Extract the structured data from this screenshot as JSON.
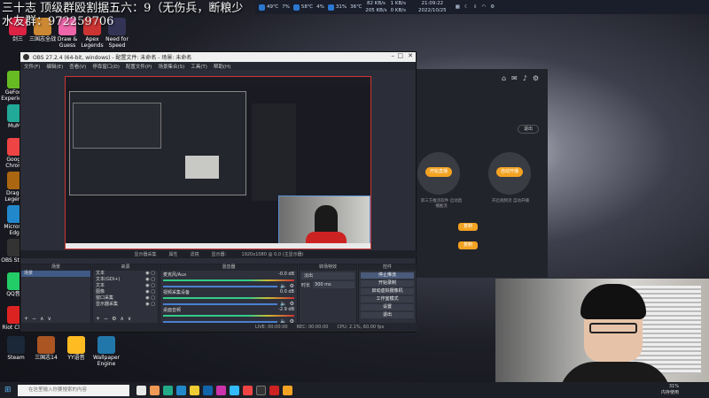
{
  "overlay": {
    "line1": "三十志 顶级群殴割据五六：9（无伤兵，断粮少",
    "line2": "水友群：972259706"
  },
  "monitor": {
    "cpu_temp": "49℃",
    "cpu_load": "7%",
    "gpu_temp": "58℃",
    "gpu_load": "4%",
    "mem": "31%",
    "disk_temp": "36℃",
    "net_up": "82 KB/s",
    "net_down": "205 KB/s",
    "net2_up": "1 KB/s",
    "net2_down": "0 KB/s",
    "time": "21:09:22",
    "date": "2022/10/25"
  },
  "desktop_icons": [
    {
      "label": "剑三",
      "color": "#d24"
    },
    {
      "label": "三国志全战",
      "color": "#c83"
    },
    {
      "label": "Draw & Guess",
      "color": "#e6a"
    },
    {
      "label": "Apex Legends",
      "color": "#c33"
    },
    {
      "label": "Need for Speed",
      "color": "#335"
    },
    {
      "label": "GeForce Experience",
      "color": "#6b2"
    },
    {
      "label": "MuMu",
      "color": "#2a9"
    },
    {
      "label": "Google Chrome",
      "color": "#e44"
    },
    {
      "label": "Dragon Legends",
      "color": "#a61"
    },
    {
      "label": "Microsoft Edge",
      "color": "#28c"
    },
    {
      "label": "OBS Studio",
      "color": "#333"
    },
    {
      "label": "QQ音乐",
      "color": "#2c6"
    },
    {
      "label": "Riot Client",
      "color": "#d22"
    },
    {
      "label": "Steam",
      "color": "#1b2838"
    },
    {
      "label": "三国志14",
      "color": "#a52"
    },
    {
      "label": "YY语音",
      "color": "#fb2"
    },
    {
      "label": "Wallpaper Engine",
      "color": "#27a"
    }
  ],
  "obs": {
    "title": "OBS 27.2.4 (64-bit, windows) - 配置文件: 未命名 - 场景: 未命名",
    "menu": [
      "文件(F)",
      "编辑(E)",
      "查看(V)",
      "停靠窗口(D)",
      "配置文件(P)",
      "场景集合(S)",
      "工具(T)",
      "帮助(H)"
    ],
    "preview_info": [
      "显示器采集",
      "属性",
      "滤镜",
      "显示器：",
      "1920x1080 @ 0,0 (主显示器)"
    ],
    "docks": {
      "scenes": {
        "header": "场景",
        "items": [
          "场景"
        ]
      },
      "sources": {
        "header": "来源",
        "items": [
          "文本",
          "文本(GDI+)",
          "文本",
          "图像",
          "窗口采集",
          "显示器采集"
        ]
      },
      "mixer": {
        "header": "混音器",
        "tracks": [
          {
            "name": "麦克风/Aux",
            "db": "-0.0 dB"
          },
          {
            "name": "视频采集设备",
            "db": "0.0 dB"
          },
          {
            "name": "桌面音频",
            "db": "-2.9 dB"
          }
        ]
      },
      "transitions": {
        "header": "转场特效",
        "type": "淡出",
        "duration_label": "时长",
        "duration": "300 ms"
      },
      "controls": {
        "header": "控件",
        "buttons": [
          "停止推流",
          "开始录制",
          "启动虚拟摄像机",
          "工作室模式",
          "设置",
          "退出"
        ]
      }
    },
    "status": [
      "LIVE: 00:00:00",
      "REC: 00:00:00",
      "CPU: 2.1%, 60.00 fps"
    ]
  },
  "bgapp": {
    "btn1": "开始直播",
    "btn2": "自动开播",
    "note1": "第三方推流软件 启动直播推流",
    "note2": "开启视频流 自动开播",
    "tag1": "复制",
    "tag2": "复制",
    "exit": "退出"
  },
  "taskbar": {
    "search_placeholder": "在这里输入你要搜索的内容",
    "tray_line1": "31%",
    "tray_line2": "内存使用"
  }
}
